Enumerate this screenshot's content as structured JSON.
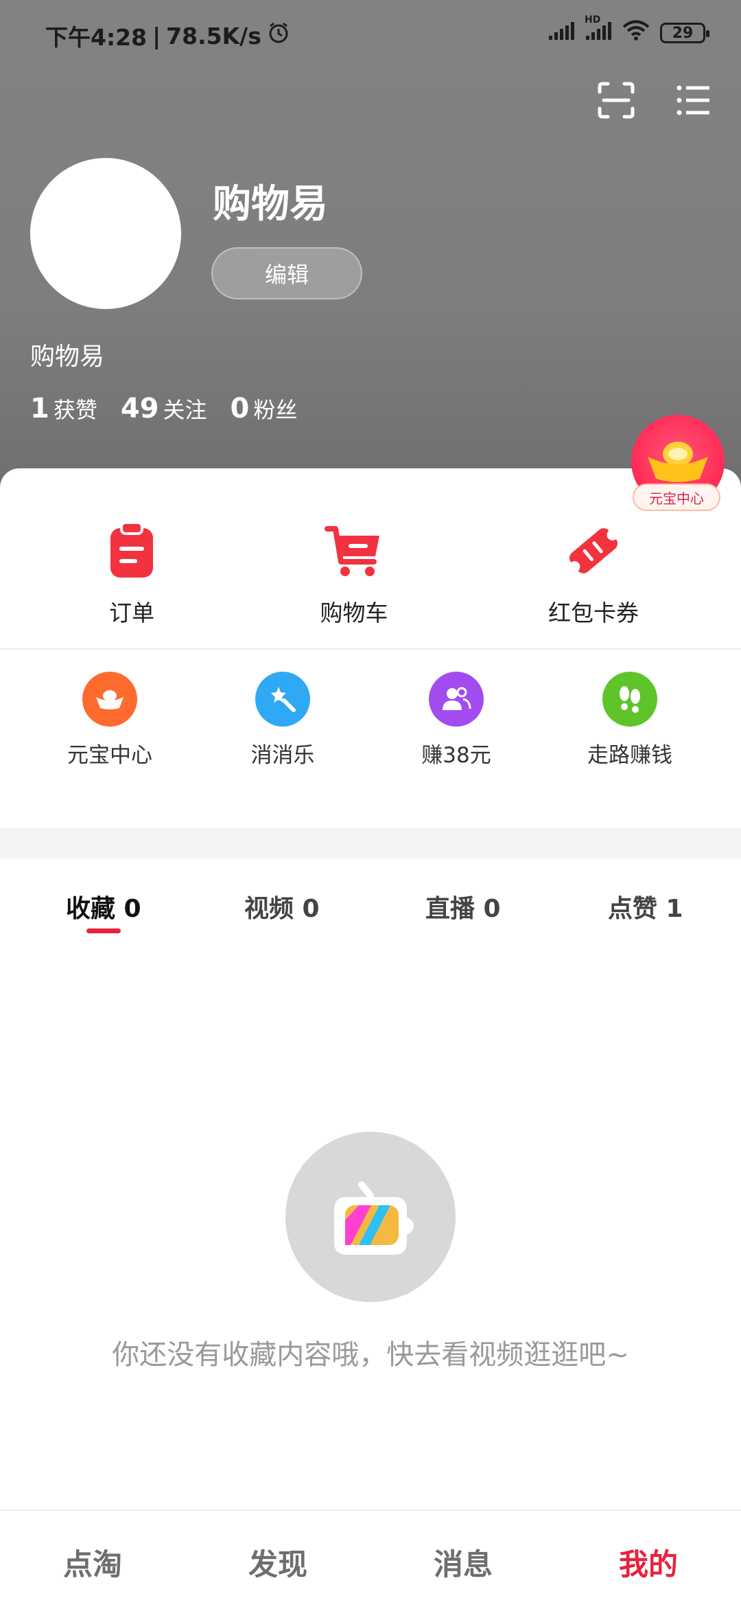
{
  "status_bar": {
    "time": "下午4:28",
    "net_speed": "78.5K/s",
    "hd_label": "HD",
    "battery": "29"
  },
  "profile": {
    "nickname": "购物易",
    "edit_label": "编辑",
    "username": "购物易",
    "stats": [
      {
        "num": "1",
        "label": "获赞"
      },
      {
        "num": "49",
        "label": "关注"
      },
      {
        "num": "0",
        "label": "粉丝"
      }
    ]
  },
  "floating_badge": {
    "label": "元宝中心"
  },
  "quick_actions": [
    {
      "label": "订单",
      "icon": "order-clipboard-icon"
    },
    {
      "label": "购物车",
      "icon": "shopping-cart-icon"
    },
    {
      "label": "红包卡券",
      "icon": "coupon-ticket-icon"
    }
  ],
  "features": [
    {
      "label": "元宝中心",
      "icon": "ingot-icon",
      "color": "#ff6a2e"
    },
    {
      "label": "消消乐",
      "icon": "star-wand-icon",
      "color": "#2fa9f5"
    },
    {
      "label": "赚38元",
      "icon": "people-icon",
      "color": "#a24cf0"
    },
    {
      "label": "走路赚钱",
      "icon": "footprint-icon",
      "color": "#5ec42a"
    }
  ],
  "tabs": [
    {
      "label": "收藏 0",
      "active": true
    },
    {
      "label": "视频 0",
      "active": false
    },
    {
      "label": "直播 0",
      "active": false
    },
    {
      "label": "点赞 1",
      "active": false
    }
  ],
  "empty_state": {
    "text": "你还没有收藏内容哦，快去看视频逛逛吧~"
  },
  "bottom_nav": [
    {
      "label": "点淘",
      "active": false
    },
    {
      "label": "发现",
      "active": false
    },
    {
      "label": "消息",
      "active": false
    },
    {
      "label": "我的",
      "active": true
    }
  ],
  "colors": {
    "accent": "#e8213d",
    "header_bg": "#808080"
  }
}
